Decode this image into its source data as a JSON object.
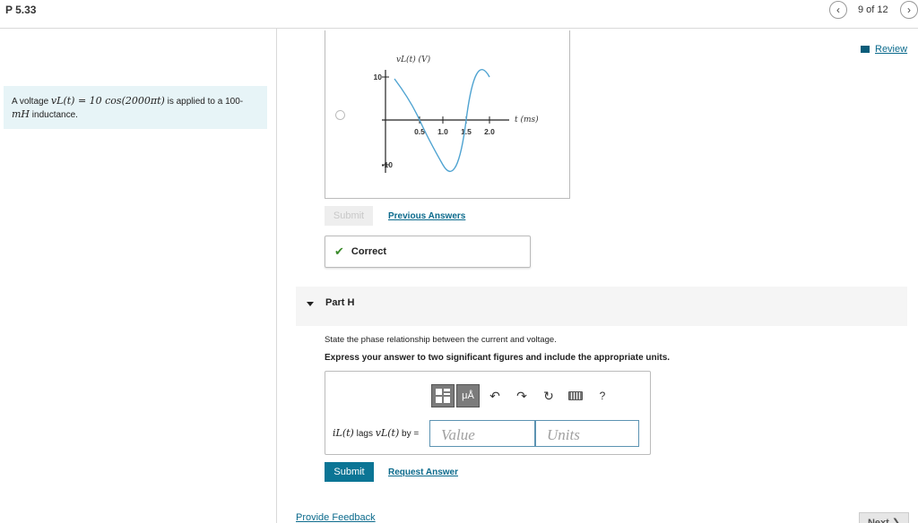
{
  "header": {
    "title": "P 5.33",
    "page_counter": "9 of 12",
    "prev_icon": "chevron-left-icon",
    "next_icon": "chevron-right-icon"
  },
  "review": {
    "label": "Review"
  },
  "problem": {
    "text_before": "A voltage ",
    "math_expr": "vL(t) = 10 cos(2000πt)",
    "text_after": " is applied to a 100-",
    "line2_math": "mH",
    "line2_text": " inductance."
  },
  "graph": {
    "ylabel": "vL(t) (V)",
    "y_ticks": [
      "10",
      "-10"
    ],
    "x_ticks": [
      "0.5",
      "1.0",
      "1.5",
      "2.0"
    ],
    "xlabel": "t (ms)"
  },
  "actions": {
    "submit_disabled": "Submit",
    "previous_answers": "Previous Answers"
  },
  "feedback": {
    "correct_label": "Correct"
  },
  "part_h": {
    "title": "Part H",
    "instruction": "State the phase relationship between the current and voltage.",
    "instruction_bold": "Express your answer to two significant figures and include the appropriate units.",
    "lags_prefix_math": "iL(t)",
    "lags_mid": " lags ",
    "lags_math2": "vL(t)",
    "lags_suffix": " by =",
    "value_placeholder": "Value",
    "units_placeholder": "Units",
    "toolbar": {
      "templates_icon": "templates-icon",
      "units_label": "μÅ",
      "undo_icon": "undo-icon",
      "redo_icon": "redo-icon",
      "reset_icon": "reset-icon",
      "keyboard_icon": "keyboard-icon",
      "help_label": "?"
    },
    "submit_label": "Submit",
    "request_answer": "Request Answer"
  },
  "footer": {
    "provide_feedback": "Provide Feedback",
    "next_label": "Next ❯"
  },
  "colors": {
    "accent": "#0b7595",
    "link": "#0b6a8c",
    "problem_bg": "#e7f4f7",
    "correct_check": "#3a8a2a"
  }
}
